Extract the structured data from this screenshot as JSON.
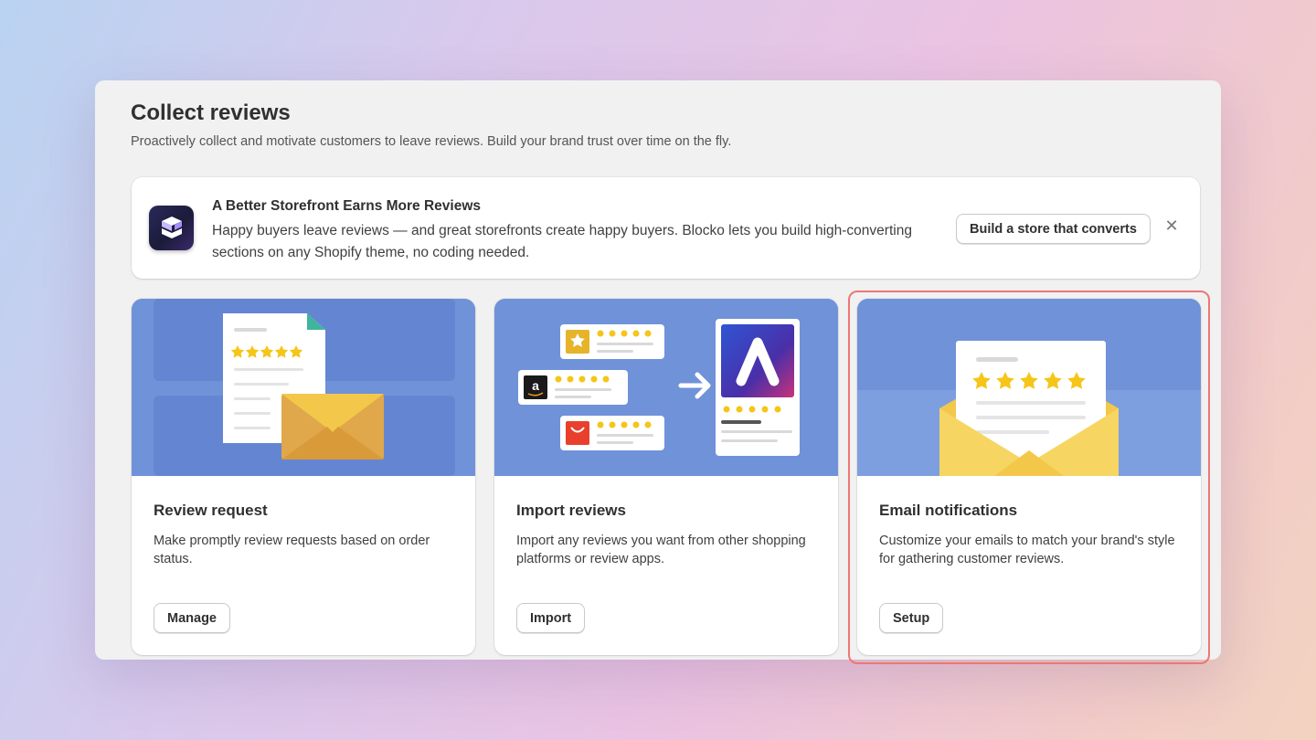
{
  "header": {
    "title": "Collect reviews",
    "subtitle": "Proactively collect and motivate customers to leave reviews. Build your brand trust over time on the fly."
  },
  "banner": {
    "title": "A Better Storefront Earns More Reviews",
    "text": "Happy buyers leave reviews — and great storefronts create happy buyers. Blocko lets you build high-converting sections on any Shopify theme, no coding needed.",
    "button_label": "Build a store that converts",
    "close_symbol": "✕",
    "logo_icon": "blocko-logo-icon"
  },
  "cards": [
    {
      "title": "Review request",
      "description": "Make promptly review requests based on order status.",
      "button_label": "Manage",
      "illustration": "document-envelope-illustration"
    },
    {
      "title": "Import reviews",
      "description": "Import any reviews you want from other shopping platforms or review apps.",
      "button_label": "Import",
      "illustration": "import-reviews-illustration"
    },
    {
      "title": "Email notifications",
      "description": "Customize your emails to match your brand's style for gathering customer reviews.",
      "button_label": "Setup",
      "illustration": "email-review-illustration",
      "highlighted": true
    }
  ],
  "colors": {
    "illustration_bg": "#7092d8",
    "star": "#f5c518",
    "highlight_border": "#ef7676"
  }
}
